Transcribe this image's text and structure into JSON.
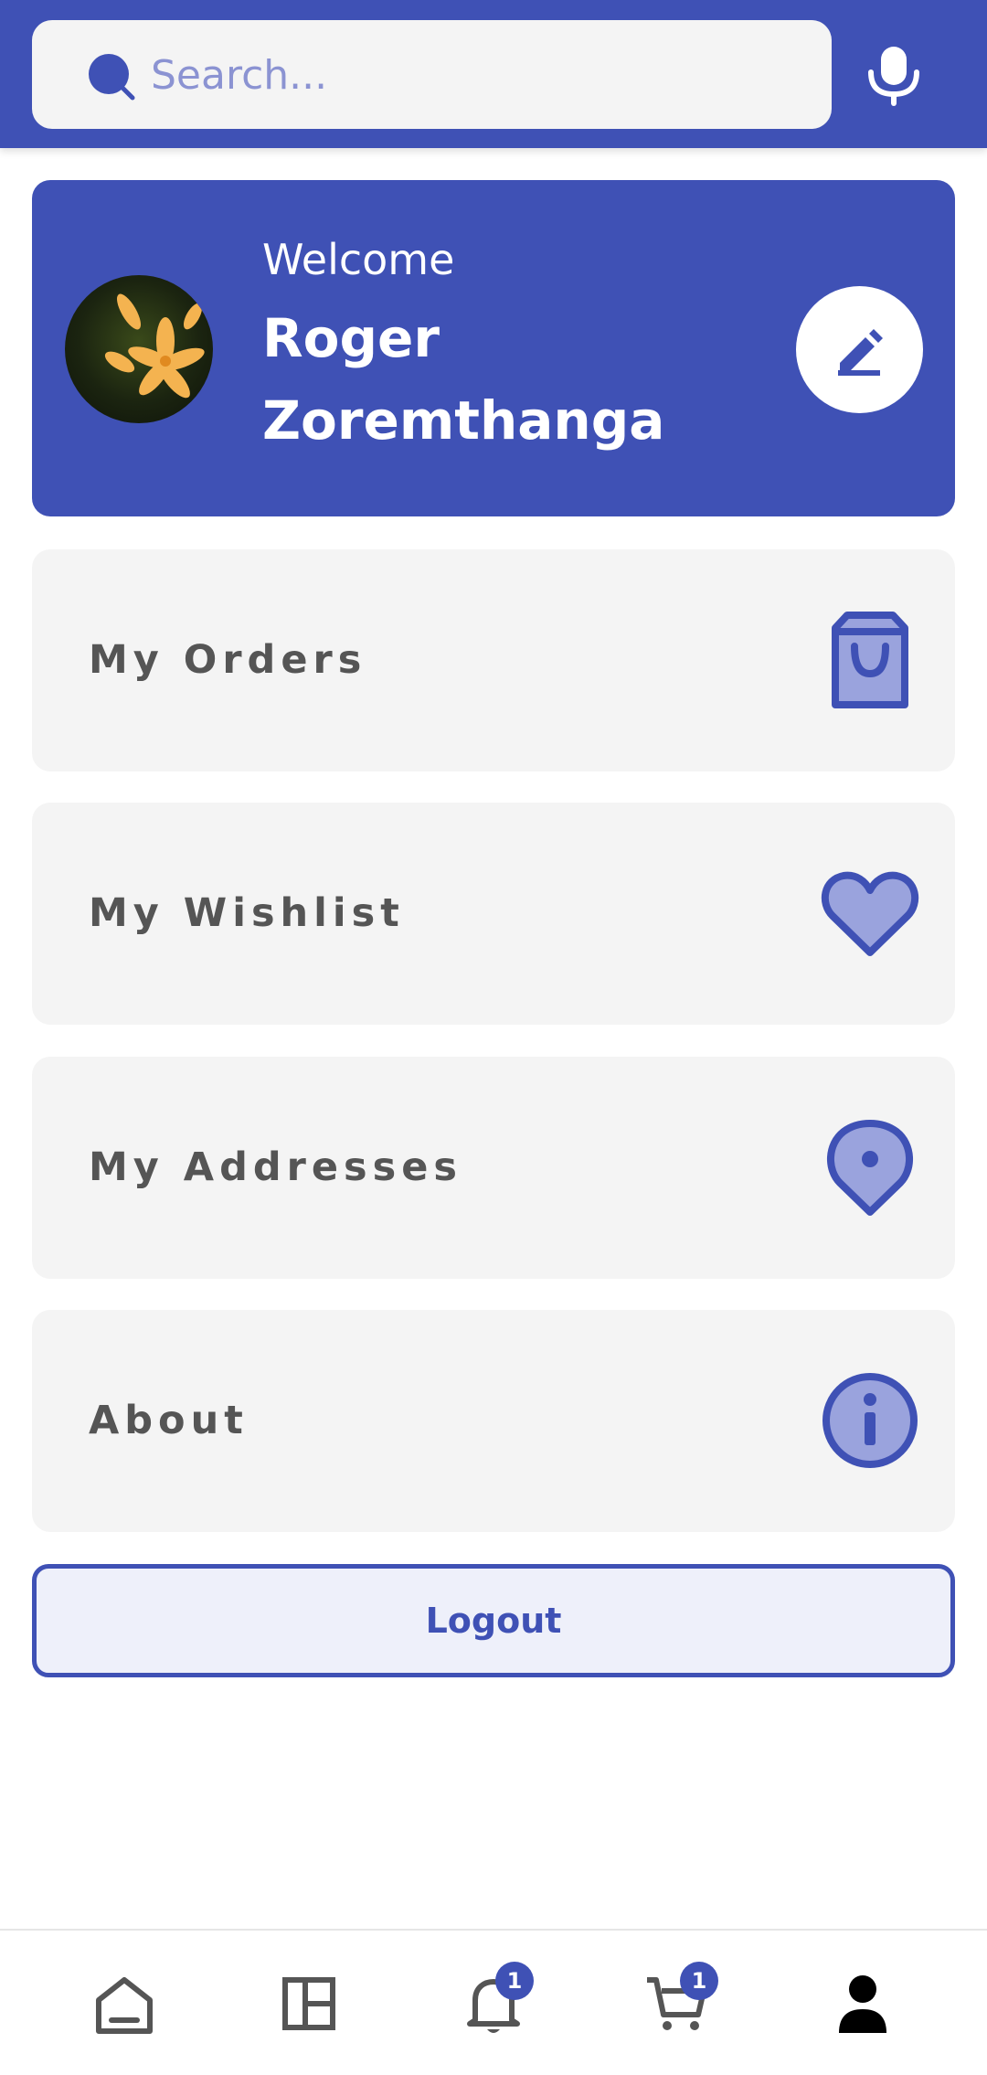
{
  "search": {
    "placeholder": "Search..."
  },
  "profile": {
    "welcome": "Welcome",
    "name": "Roger Zoremthanga"
  },
  "menu": [
    {
      "label": "My Orders",
      "icon": "shopping-bag-icon"
    },
    {
      "label": "My Wishlist",
      "icon": "heart-icon"
    },
    {
      "label": "My Addresses",
      "icon": "location-pin-icon"
    },
    {
      "label": "About",
      "icon": "info-icon"
    }
  ],
  "logout": {
    "label": "Logout"
  },
  "bottom_nav": {
    "items": [
      {
        "name": "home",
        "icon": "home-icon"
      },
      {
        "name": "categories",
        "icon": "layout-icon"
      },
      {
        "name": "notifications",
        "icon": "bell-icon",
        "badge": "1"
      },
      {
        "name": "cart",
        "icon": "cart-icon",
        "badge": "1"
      },
      {
        "name": "profile",
        "icon": "person-icon"
      }
    ]
  },
  "colors": {
    "primary": "#3F51B5",
    "icon_fill": "#9AA3DD",
    "card_bg": "#F4F4F4",
    "label_text": "#555555"
  }
}
